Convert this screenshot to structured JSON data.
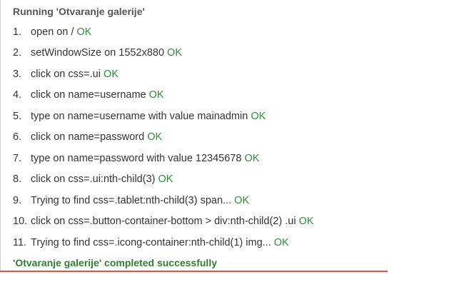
{
  "header": {
    "title": "Running 'Otvaranje galerije'"
  },
  "steps": [
    {
      "num": "1.",
      "text": "open on /",
      "status": "OK"
    },
    {
      "num": "2.",
      "text": "setWindowSize on 1552x880",
      "status": "OK"
    },
    {
      "num": "3.",
      "text": "click on css=.ui",
      "status": "OK"
    },
    {
      "num": "4.",
      "text": "click on name=username",
      "status": "OK"
    },
    {
      "num": "5.",
      "text": "type on name=username with value mainadmin",
      "status": "OK"
    },
    {
      "num": "6.",
      "text": "click on name=password",
      "status": "OK"
    },
    {
      "num": "7.",
      "text": "type on name=password with value 12345678",
      "status": "OK"
    },
    {
      "num": "8.",
      "text": "click on css=.ui:nth-child(3)",
      "status": "OK"
    },
    {
      "num": "9.",
      "text": "Trying to find css=.tablet:nth-child(3) span...",
      "status": "OK"
    },
    {
      "num": "10.",
      "text": "click on css=.button-container-bottom > div:nth-child(2) .ui",
      "status": "OK"
    },
    {
      "num": "11.",
      "text": "Trying to find css=.icong-container:nth-child(1) img...",
      "status": "OK"
    }
  ],
  "footer": {
    "message": "'Otvaranje galerije' completed successfully"
  },
  "colors": {
    "ok": "#2e8b3a",
    "success": "#2e7d32",
    "divider": "#d9534f"
  }
}
